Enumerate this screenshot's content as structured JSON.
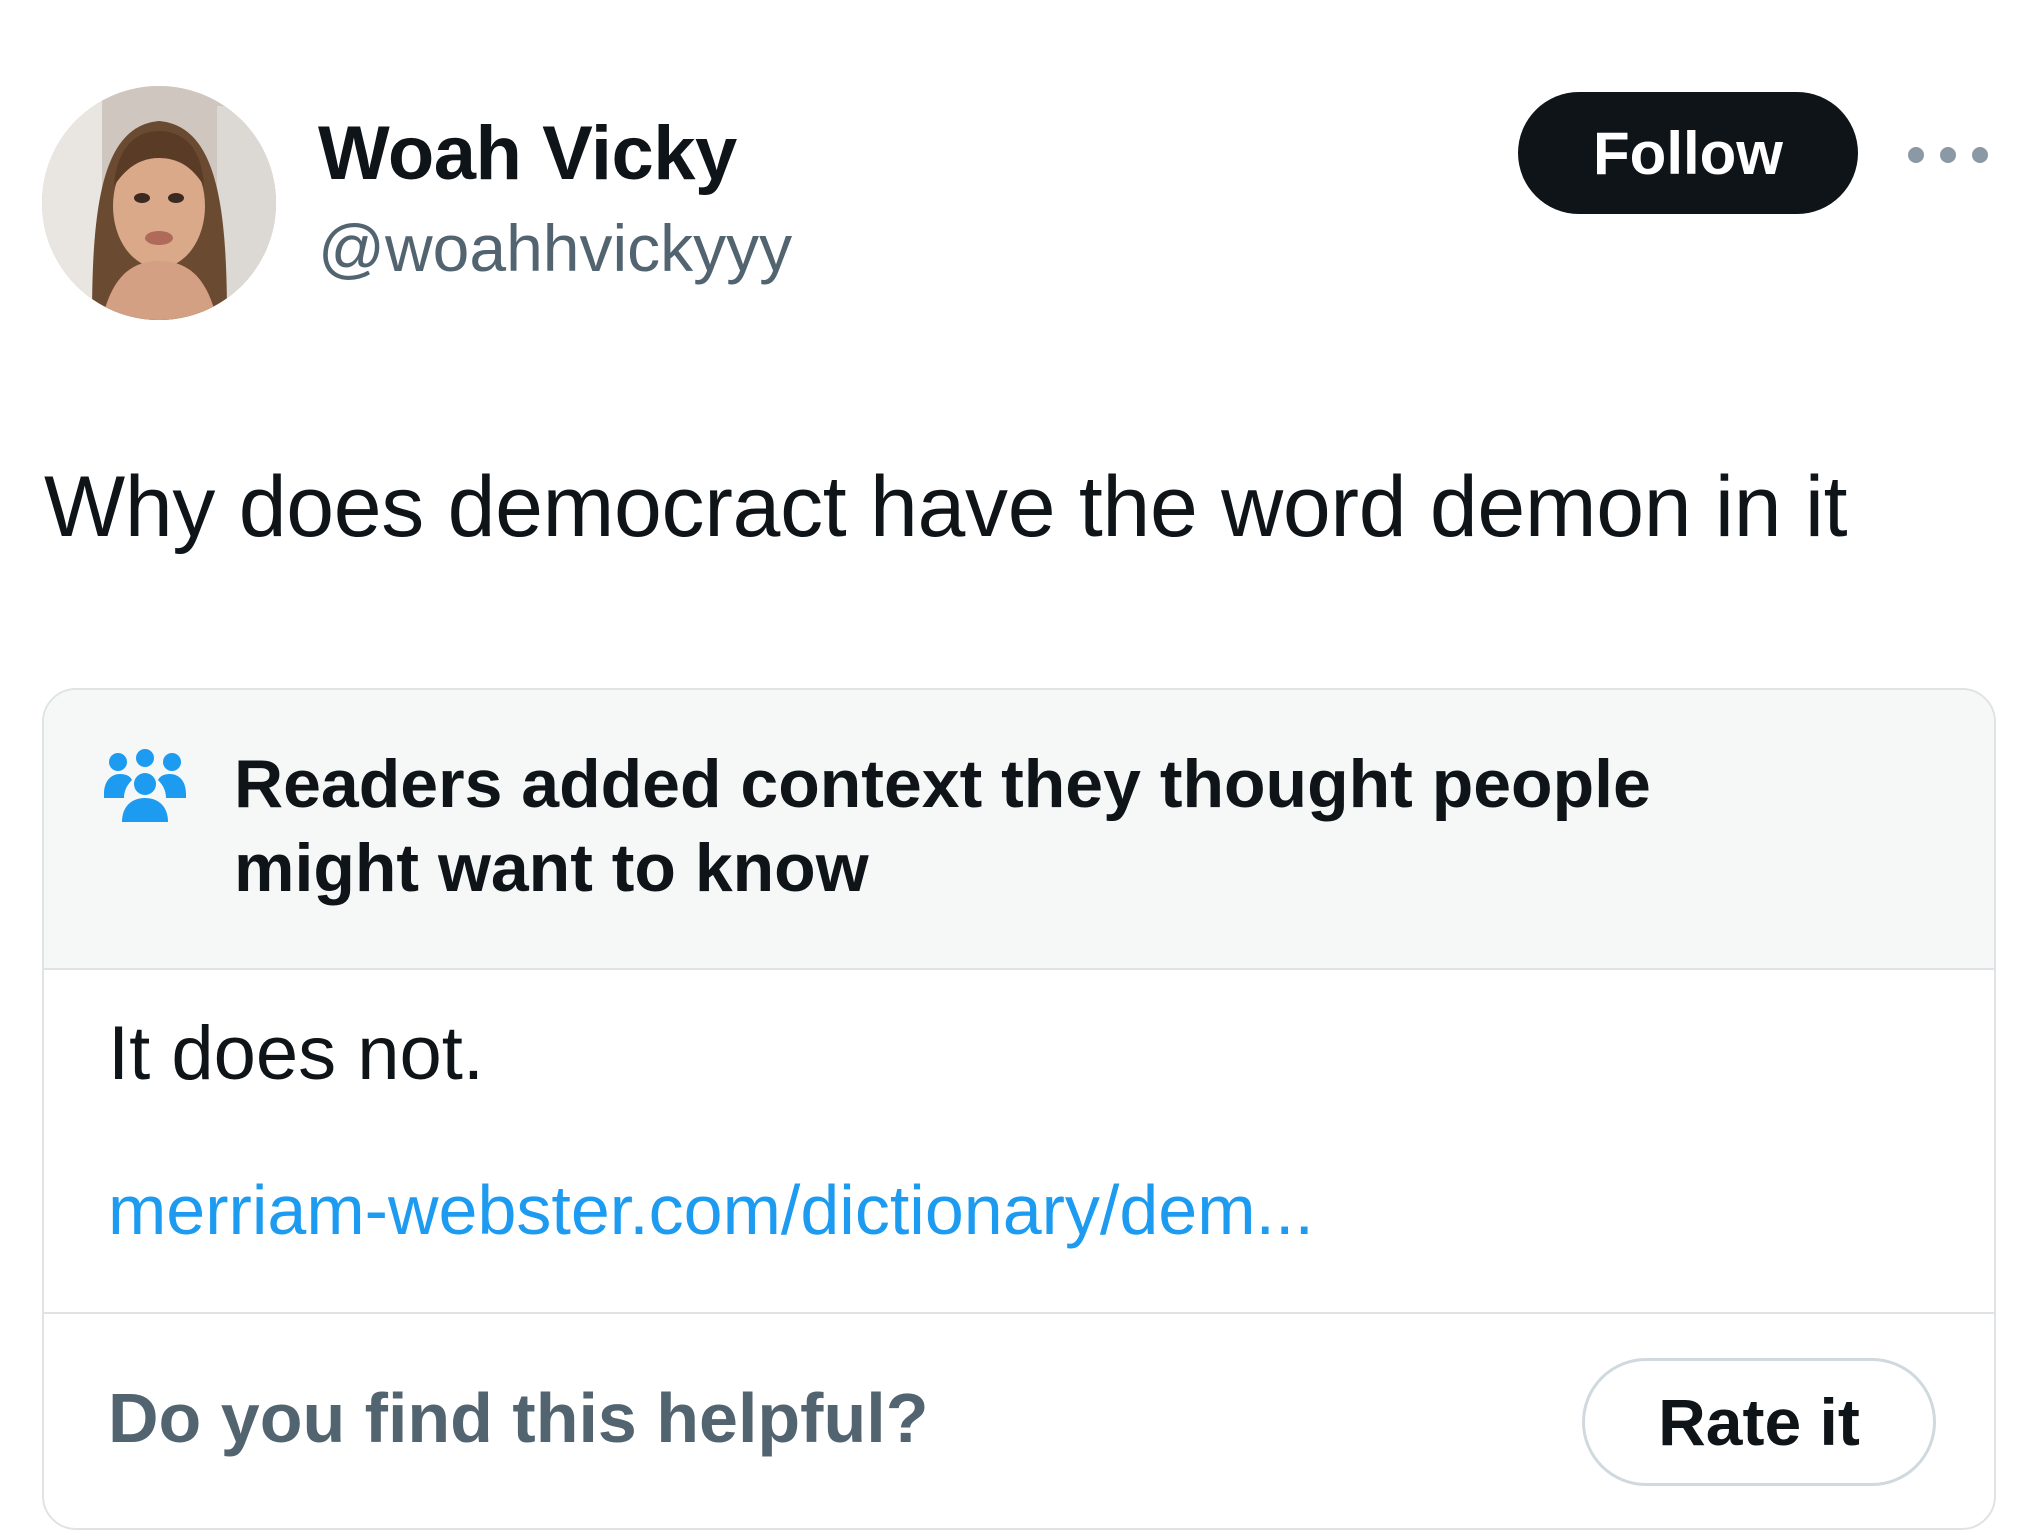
{
  "author": {
    "display_name": "Woah Vicky",
    "handle": "@woahhvickyyy",
    "avatar_icon": "profile-photo"
  },
  "actions": {
    "follow_label": "Follow",
    "more_icon": "more-horizontal-icon"
  },
  "tweet": {
    "text": "Why does democract have the word demon in it"
  },
  "community_note": {
    "icon": "people-icon",
    "title": "Readers added context they thought people might want to know",
    "body": "It does not.",
    "link_text": "merriam-webster.com/dictionary/dem...",
    "helpful_question": "Do you find this helpful?",
    "rate_label": "Rate it"
  },
  "colors": {
    "text_primary": "#0f1419",
    "text_secondary": "#536471",
    "link": "#1d9bf0",
    "border": "#dfe3e6",
    "note_header_bg": "#f6f8f8"
  }
}
